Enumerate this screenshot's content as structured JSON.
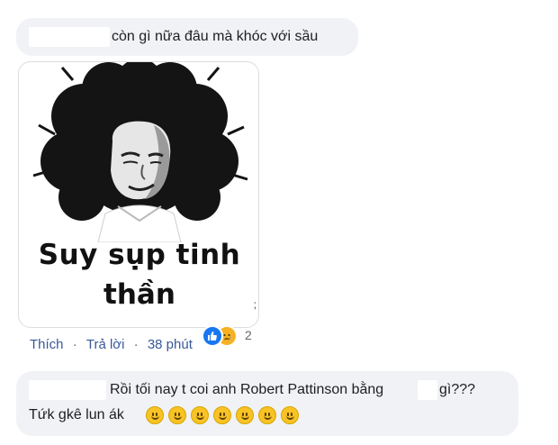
{
  "comment1": {
    "text": "còn gì nữa đâu mà khóc với sầu",
    "sticker": {
      "caption_line1": "Suy sụp tinh",
      "caption_line2": "thần",
      "corner_mark": ";"
    },
    "actions": {
      "like": "Thích",
      "reply": "Trả lời",
      "separator": "·",
      "time": "38 phút"
    },
    "reactions": {
      "icons": [
        "like-icon",
        "sad-icon"
      ],
      "count": "2"
    }
  },
  "comment2": {
    "text_part1": "Rồi tối nay t coi anh Robert Pattinson bằng",
    "text_part2": "gì???",
    "text_line2": "Tứk gkê lun ák",
    "emoji_count": 7,
    "emoji_name": "smiley-icon"
  },
  "colors": {
    "bubble": "#f0f2f5",
    "link": "#385898",
    "meta": "#65676b",
    "like": "#1877f2",
    "sad": "#f7b125"
  }
}
